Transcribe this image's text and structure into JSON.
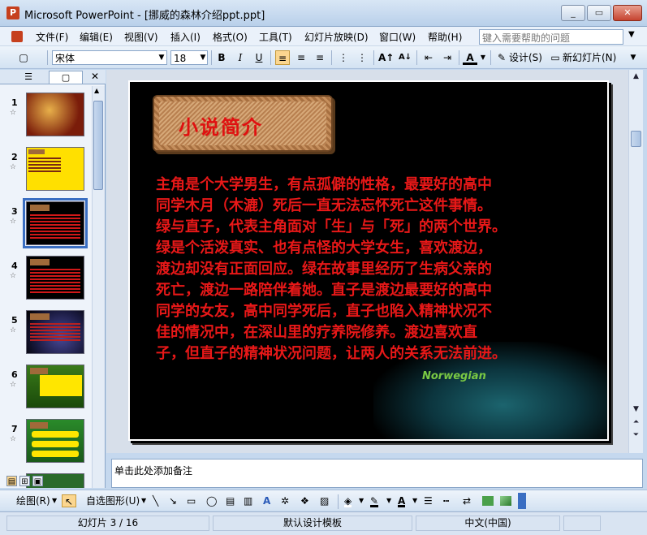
{
  "window": {
    "title": "Microsoft PowerPoint - [挪威的森林介绍ppt.ppt]",
    "minimize": "_",
    "restore": "▭",
    "close": "✕"
  },
  "menu": {
    "items": [
      "文件(F)",
      "编辑(E)",
      "视图(V)",
      "插入(I)",
      "格式(O)",
      "工具(T)",
      "幻灯片放映(D)",
      "窗口(W)",
      "帮助(H)"
    ],
    "help_placeholder": "键入需要帮助的问题"
  },
  "toolbar": {
    "font_name": "宋体",
    "font_size": "18",
    "bold": "B",
    "italic": "I",
    "underline": "U",
    "design_label": "设计(S)",
    "new_slide_label": "新幻灯片(N)"
  },
  "left_panel": {
    "tabs": [
      "☰",
      "▢"
    ],
    "close": "✕",
    "slides": [
      {
        "num": "1",
        "bg": "#7a1c0a",
        "accent": "#e8b04a"
      },
      {
        "num": "2",
        "bg": "#ffe000",
        "accent": "#7a2a12"
      },
      {
        "num": "3",
        "bg": "#000000",
        "accent": "#d01818"
      },
      {
        "num": "4",
        "bg": "#000000",
        "accent": "#d01818"
      },
      {
        "num": "5",
        "bg": "#1a1a40",
        "accent": "#b82020"
      },
      {
        "num": "6",
        "bg": "#3a7a1a",
        "accent": "#ffe600"
      },
      {
        "num": "7",
        "bg": "#2a8a2a",
        "accent": "#ffe600"
      }
    ],
    "star": "☆"
  },
  "slide": {
    "title": "小说简介",
    "body_lines": [
      "主角是个大学男生，有点孤僻的性格，最要好的高中",
      "同学木月（木漉）死后一直无法忘怀死亡这件事情。",
      "绿与直子，代表主角面对「生」与「死」的两个世界。",
      "绿是个活泼真实、也有点怪的大学女生，喜欢渡边，",
      "渡边却没有正面回应。绿在故事里经历了生病父亲的",
      "死亡，渡边一路陪伴着她。直子是渡边最要好的高中",
      "同学的女友，高中同学死后，直子也陷入精神状况不",
      "佳的情况中，在深山里的疗养院修养。渡边喜欢直",
      "子，但直子的精神状况问题，让两人的关系无法前进。"
    ],
    "bg_logo": "Norwegian"
  },
  "notes": {
    "placeholder": "单击此处添加备注"
  },
  "drawbar": {
    "draw_label": "绘图(R)",
    "autoshape_label": "自选图形(U)"
  },
  "status": {
    "slide_info": "幻灯片 3 / 16",
    "template": "默认设计模板",
    "language": "中文(中国)"
  },
  "colors": {
    "slide_text": "#e81818",
    "selection": "#3a6ec2"
  }
}
